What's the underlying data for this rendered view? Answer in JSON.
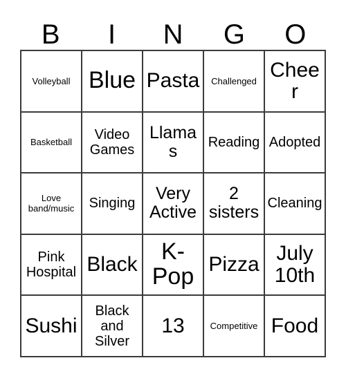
{
  "card": {
    "title": "BINGO Card",
    "header_letters": [
      "B",
      "I",
      "N",
      "G",
      "O"
    ],
    "border_color": "#3a3a3a",
    "background_color": "#ffffff",
    "text_color": "#000000",
    "rows": 5,
    "columns": 5,
    "cells": [
      [
        {
          "text": "Volleyball",
          "size": "fs-xs"
        },
        {
          "text": "Blue",
          "size": "fs-xxl"
        },
        {
          "text": "Pasta",
          "size": "fs-xl"
        },
        {
          "text": "Challenged",
          "size": "fs-xs"
        },
        {
          "text": "Cheer",
          "size": "fs-xl"
        }
      ],
      [
        {
          "text": "Basketball",
          "size": "fs-xs"
        },
        {
          "text": "Video Games",
          "size": "fs-md"
        },
        {
          "text": "Llamas",
          "size": "fs-lg"
        },
        {
          "text": "Reading",
          "size": "fs-md"
        },
        {
          "text": "Adopted",
          "size": "fs-md"
        }
      ],
      [
        {
          "text": "Love band/music",
          "size": "fs-xs"
        },
        {
          "text": "Singing",
          "size": "fs-md"
        },
        {
          "text": "Very Active",
          "size": "fs-lg"
        },
        {
          "text": "2 sisters",
          "size": "fs-lg"
        },
        {
          "text": "Cleaning",
          "size": "fs-md"
        }
      ],
      [
        {
          "text": "Pink Hospital",
          "size": "fs-md"
        },
        {
          "text": "Black",
          "size": "fs-xl"
        },
        {
          "text": "K-Pop",
          "size": "fs-xxl"
        },
        {
          "text": "Pizza",
          "size": "fs-xl"
        },
        {
          "text": "July 10th",
          "size": "fs-xl"
        }
      ],
      [
        {
          "text": "Sushi",
          "size": "fs-xl"
        },
        {
          "text": "Black and Silver",
          "size": "fs-md"
        },
        {
          "text": "13",
          "size": "fs-xl"
        },
        {
          "text": "Competitive",
          "size": "fs-xs"
        },
        {
          "text": "Food",
          "size": "fs-xl"
        }
      ]
    ]
  }
}
